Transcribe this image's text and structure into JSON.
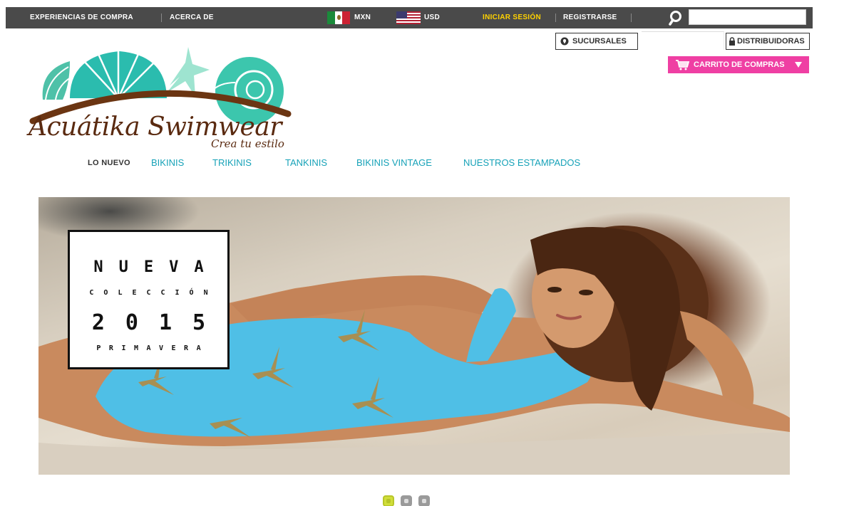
{
  "topbar": {
    "experiencias": "EXPERIENCIAS DE COMPRA",
    "acerca": "ACERCA DE",
    "currency_mxn": "MXN",
    "currency_usd": "USD",
    "login": "INICIAR SESIÓN",
    "register": "REGISTRARSE",
    "search_value": "",
    "login_color": "#ffd200"
  },
  "header": {
    "sucursales": "SUCURSALES",
    "distribuidoras": "DISTRIBUIDORAS",
    "cart": "CARRITO DE COMPRAS",
    "cart_color": "#ef3fa3"
  },
  "logo": {
    "name": "Acuátika Swimwear",
    "tagline": "Crea tu estilo"
  },
  "nav": {
    "items": [
      "LO NUEVO",
      "BIKINIS",
      "TRIKINIS",
      "TANKINIS",
      "BIKINIS VINTAGE",
      "NUESTROS ESTAMPADOS"
    ]
  },
  "hero": {
    "line1": "NUEVA",
    "line2": "COLECCIÓN",
    "line3": "2015",
    "line4": "PRIMAVERA"
  },
  "slider": {
    "count": 3,
    "active_index": 0
  }
}
